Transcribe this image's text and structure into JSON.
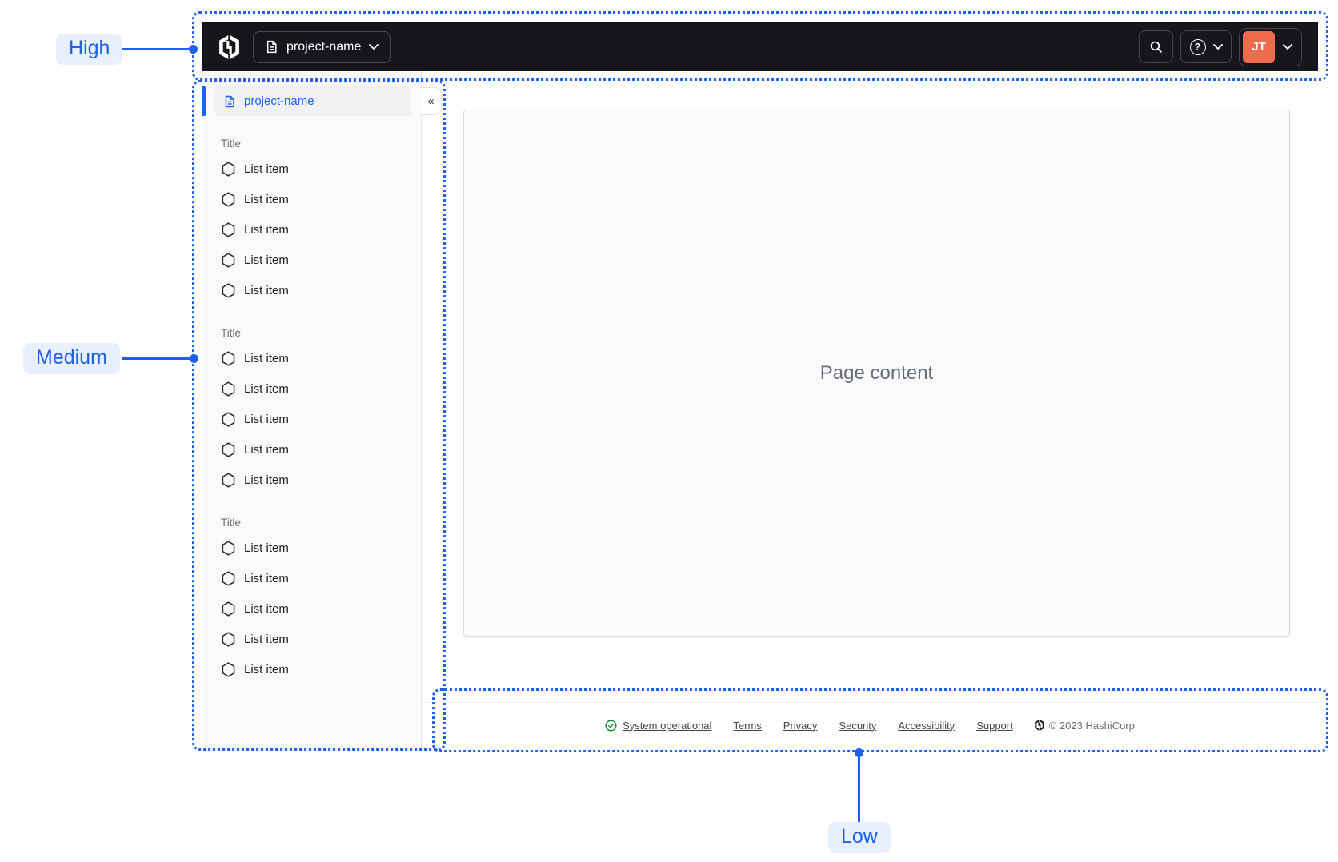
{
  "navbar": {
    "project_selector": {
      "label": "project-name"
    },
    "avatar_initials": "JT",
    "icons": [
      "hashicorp-logo",
      "file-text-icon",
      "chevron-down-icon",
      "search-icon",
      "help-icon"
    ]
  },
  "sidebar": {
    "project": {
      "label": "project-name"
    },
    "collapse_icon": "«",
    "sections": [
      {
        "title": "Title",
        "items": [
          "List item",
          "List item",
          "List item",
          "List item",
          "List item"
        ]
      },
      {
        "title": "Title",
        "items": [
          "List item",
          "List item",
          "List item",
          "List item",
          "List item"
        ]
      },
      {
        "title": "Title",
        "items": [
          "List item",
          "List item",
          "List item",
          "List item",
          "List item"
        ]
      }
    ]
  },
  "main": {
    "placeholder": "Page content"
  },
  "footer": {
    "status": {
      "label": "System operational"
    },
    "links": [
      "Terms",
      "Privacy",
      "Security",
      "Accessibility",
      "Support"
    ],
    "copyright": "© 2023 HashiCorp"
  },
  "annotations": {
    "high": {
      "label": "High"
    },
    "medium": {
      "label": "Medium"
    },
    "low": {
      "label": "Low"
    }
  },
  "colors": {
    "annotation_blue": "#1e5ff2",
    "annotation_pill_bg": "#e8effd",
    "navbar_bg": "#16171a",
    "avatar_orange": "#ee6c4e",
    "selected_blue": "#1c61f0",
    "sidebar_bg": "#fafafa",
    "status_green": "#0f8b30"
  }
}
